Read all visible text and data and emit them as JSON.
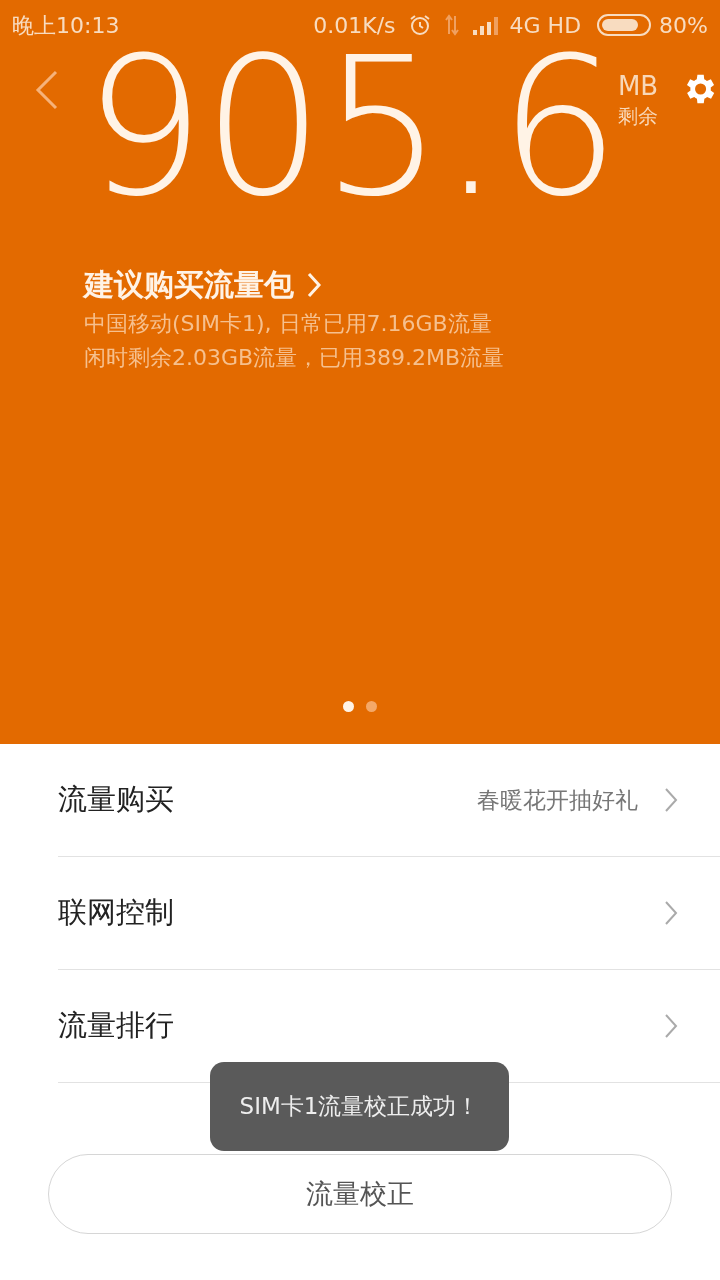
{
  "status_bar": {
    "time": "晚上10:13",
    "speed": "0.01K/s",
    "network": "4G HD",
    "battery": "80%"
  },
  "header": {
    "remaining": "905.6",
    "unit": "MB",
    "unit_label": "剩余",
    "suggestion": "建议购买流量包",
    "info_lines": [
      "中国移动(SIM卡1), 日常已用7.16GB流量",
      "闲时剩余2.03GB流量，已用389.2MB流量"
    ]
  },
  "pager": [
    {
      "selected": true
    },
    {
      "selected": false
    }
  ],
  "menu": [
    {
      "label": "流量购买",
      "detail": "春暖花开抽好礼"
    },
    {
      "label": "联网控制"
    },
    {
      "label": "流量排行"
    }
  ],
  "calibrate_button": "流量校正",
  "toast": "SIM卡1流量校正成功！"
}
